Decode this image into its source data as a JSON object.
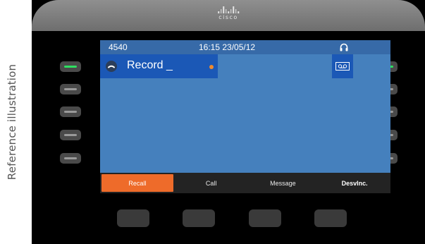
{
  "caption": "Reference illustration",
  "brand": {
    "name": "cisco"
  },
  "status_bar": {
    "extension": "4540",
    "datetime": "16:15 23/05/12",
    "icon": "headset-icon"
  },
  "line": {
    "label": "Record _",
    "icon": "handset-icon",
    "indicator_color": "#ee8a2e"
  },
  "right_line": {
    "icon": "voicemail-icon"
  },
  "softkeys": [
    {
      "label": "Recall",
      "active": true
    },
    {
      "label": "Call"
    },
    {
      "label": "Message"
    },
    {
      "label": "DesvInc."
    }
  ],
  "left_line_buttons": [
    {
      "lit": true
    },
    {
      "lit": false
    },
    {
      "lit": false
    },
    {
      "lit": false
    },
    {
      "lit": false
    }
  ],
  "right_line_buttons": [
    {
      "lit": true
    },
    {
      "lit": false
    },
    {
      "lit": false
    },
    {
      "lit": false
    },
    {
      "lit": false
    }
  ],
  "colors": {
    "screen": "#4580bd",
    "selected_line": "#1b58b6",
    "active_softkey": "#ee6b2a",
    "lit_led": "#2ee060"
  }
}
